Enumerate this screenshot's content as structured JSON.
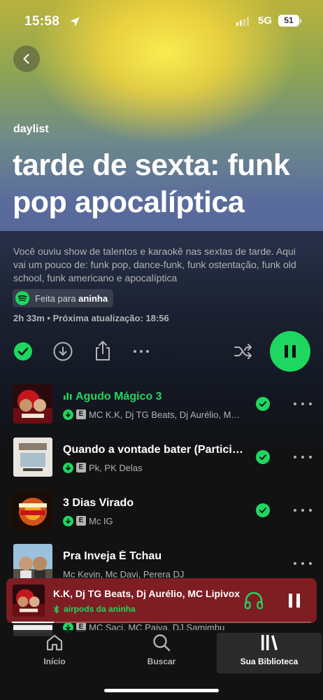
{
  "status_bar": {
    "time": "15:58",
    "network": "5G",
    "battery": "51"
  },
  "header": {
    "kicker": "daylist",
    "title": "tarde de sexta: funk pop apocalíptica"
  },
  "description": "Você ouviu show de talentos e karaokê nas sextas de tarde. Aqui vai um pouco de: funk pop, dance-funk, funk ostentação, funk old school, funk americano e apocalíptica",
  "made_for": {
    "prefix": "Feita para",
    "user": "aninha"
  },
  "meta": "2h 33m • Próxima atualização: 18:56",
  "tracks": [
    {
      "title": "Agudo Mágico 3",
      "artists": "MC K.K, Dj TG Beats, Dj Aurélio, MC Lipivox",
      "playing": true,
      "downloaded": true,
      "explicit": true,
      "saved": true
    },
    {
      "title": "Quando a vontade bater (Participação especial de PK)",
      "artists": "Pk, PK Delas",
      "playing": false,
      "downloaded": true,
      "explicit": true,
      "saved": true
    },
    {
      "title": "3 Dias Virado",
      "artists": "Mc IG",
      "playing": false,
      "downloaded": true,
      "explicit": true,
      "saved": true
    },
    {
      "title": "Pra Inveja É Tchau",
      "artists": "Mc Kevin, Mc Davi, Perera DJ",
      "playing": false,
      "downloaded": false,
      "explicit": false,
      "saved": false
    },
    {
      "title": "",
      "artists": "MC Saci, MC Paiva, DJ Samimbu",
      "playing": false,
      "downloaded": true,
      "explicit": true,
      "saved": false
    }
  ],
  "now_playing": {
    "artists": "K.K, Dj TG Beats, Dj Aurélio, MC Lipivox",
    "device": "airpods da aninha",
    "progress": 0.14
  },
  "nav": {
    "home": "Início",
    "search": "Buscar",
    "library": "Sua Biblioteca"
  },
  "colors": {
    "accent": "#1ed760",
    "mini_player": "#7e1d22",
    "background": "#121212"
  }
}
